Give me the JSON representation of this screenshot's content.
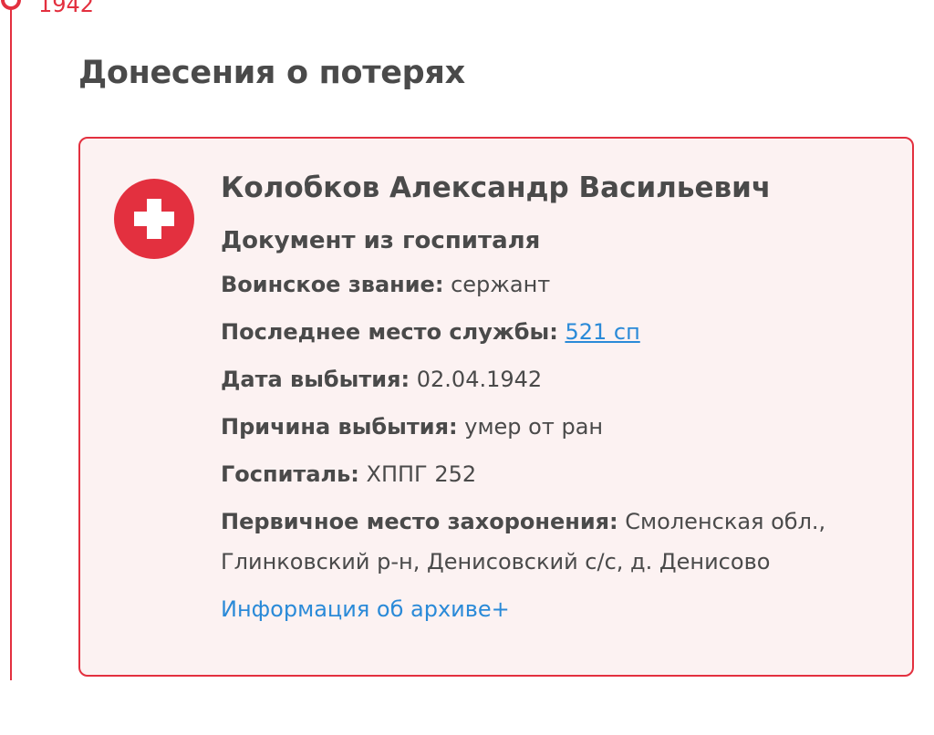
{
  "timeline": {
    "year": "1942"
  },
  "section": {
    "title": "Донесения о потерях"
  },
  "card": {
    "icon": "medical-cross-icon",
    "name": "Колобков Александр Васильевич",
    "doc_type": "Документ из госпиталя",
    "fields": [
      {
        "label": "Воинское звание:",
        "value": "сержант"
      },
      {
        "label": "Последнее место службы:",
        "value": "521 сп",
        "is_link": true
      },
      {
        "label": "Дата выбытия:",
        "value": "02.04.1942"
      },
      {
        "label": "Причина выбытия:",
        "value": "умер от ран"
      },
      {
        "label": "Госпиталь:",
        "value": "ХППГ 252"
      },
      {
        "label": "Первичное место захоронения:",
        "value": "Смоленская обл., Глинковский р-н, Денисовский с/с, д. Денисово"
      }
    ],
    "archive_link": "Информация об архиве+"
  },
  "colors": {
    "accent": "#e3303f",
    "card_bg": "#fcf2f2",
    "link": "#2a8ad8",
    "text": "#4a4a4a"
  }
}
